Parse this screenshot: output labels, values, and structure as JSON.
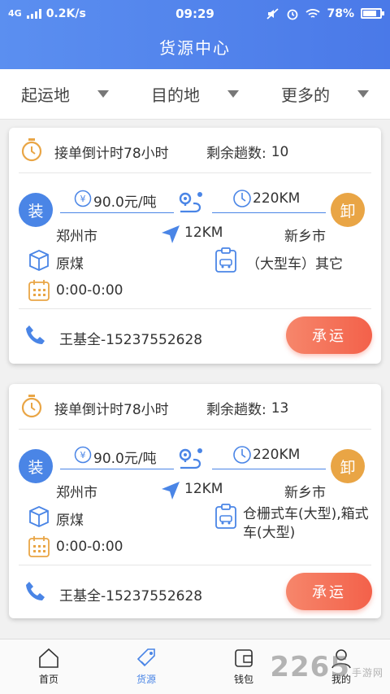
{
  "status_bar": {
    "network": "4G",
    "speed": "0.2K/s",
    "time": "09:29",
    "battery": "78%",
    "battery_level": 0.78
  },
  "header": {
    "title": "货源中心"
  },
  "filters": [
    {
      "label": "起运地"
    },
    {
      "label": "目的地"
    },
    {
      "label": "更多的"
    }
  ],
  "cards": [
    {
      "countdown": "接单倒计时78小时",
      "remaining_label": "剩余趟数:",
      "remaining": "10",
      "load_badge": "装",
      "unload_badge": "卸",
      "price": "90.0元/吨",
      "distance_total": "220KM",
      "origin": "郑州市",
      "distance_near": "12KM",
      "destination": "新乡市",
      "cargo": "原煤",
      "vehicle": "（大型车）其它",
      "time_window": "0:00-0:00",
      "contact": "王基全-15237552628",
      "action": "承运"
    },
    {
      "countdown": "接单倒计时78小时",
      "remaining_label": "剩余趟数:",
      "remaining": "13",
      "load_badge": "装",
      "unload_badge": "卸",
      "price": "90.0元/吨",
      "distance_total": "220KM",
      "origin": "郑州市",
      "distance_near": "12KM",
      "destination": "新乡市",
      "cargo": "原煤",
      "vehicle": "仓栅式车(大型),箱式车(大型)",
      "time_window": "0:00-0:00",
      "contact": "王基全-15237552628",
      "action": "承运"
    }
  ],
  "tabbar": [
    {
      "label": "首页",
      "icon": "home-icon"
    },
    {
      "label": "货源",
      "icon": "tag-icon",
      "active": true
    },
    {
      "label": "钱包",
      "icon": "wallet-icon"
    },
    {
      "label": "我的",
      "icon": "user-icon"
    }
  ],
  "watermark": {
    "text": "2265",
    "sub": "手游网"
  },
  "colors": {
    "primary": "#4a85e6",
    "accent_orange": "#e9a545",
    "button": "#f3614a"
  }
}
